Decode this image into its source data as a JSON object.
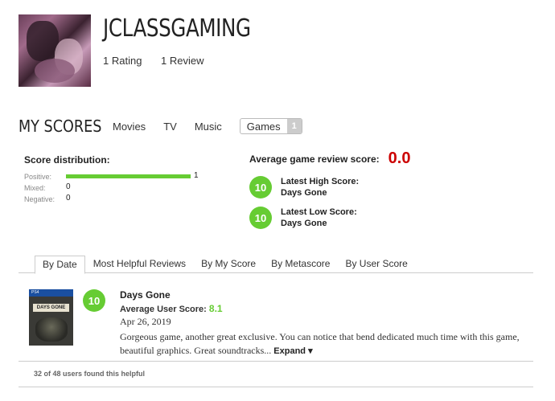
{
  "profile": {
    "username": "JCLASSGAMING",
    "ratings": "1 Rating",
    "reviews": "1 Review"
  },
  "scores": {
    "title": "MY SCORES",
    "nav": [
      "Movies",
      "TV",
      "Music"
    ],
    "games_label": "Games",
    "games_count": "1"
  },
  "distribution": {
    "title": "Score distribution:",
    "rows": [
      {
        "label": "Positive:",
        "value": "1",
        "fraction": 1.0
      },
      {
        "label": "Mixed:",
        "value": "0",
        "fraction": 0
      },
      {
        "label": "Negative:",
        "value": "0",
        "fraction": 0
      }
    ],
    "bar_color": "#66cc33"
  },
  "average": {
    "label": "Average game review score:",
    "value": "0.0",
    "value_color": "#cc0000",
    "high": {
      "badge": "10",
      "label": "Latest High Score:",
      "game": "Days Gone"
    },
    "low": {
      "badge": "10",
      "label": "Latest Low Score:",
      "game": "Days Gone"
    }
  },
  "tabs": [
    "By Date",
    "Most Helpful Reviews",
    "By My Score",
    "By Metascore",
    "By User Score"
  ],
  "review": {
    "cover_platform": "PS4",
    "cover_title": "DAYS GONE",
    "badge": "10",
    "game": "Days Gone",
    "avg_user_label": "Average User Score:",
    "avg_user_value": "8.1",
    "date": "Apr 26, 2019",
    "text": "Gorgeous game, another great exclusive. You can notice that bend dedicated much time with this game, beautiful graphics. Great soundtracks... ",
    "expand": "Expand ▾",
    "helpful": "32 of 48 users found this helpful"
  }
}
